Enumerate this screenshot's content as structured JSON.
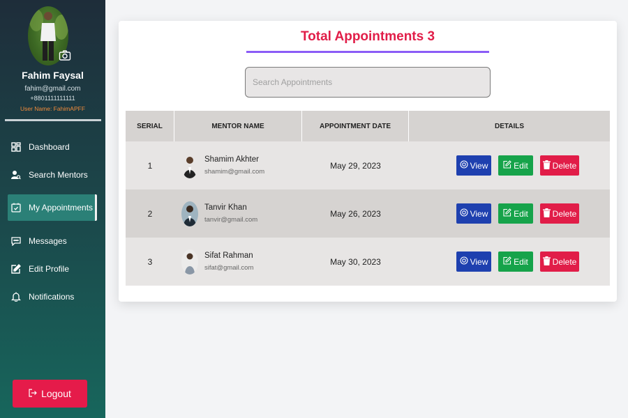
{
  "sidebar": {
    "profile": {
      "name": "Fahim Faysal",
      "email": "fahim@gmail.com",
      "phone": "+8801111111111",
      "username": "User Name: FahimAPFF"
    },
    "items": [
      {
        "label": "Dashboard",
        "icon": "dashboard-icon"
      },
      {
        "label": "Search Mentors",
        "icon": "user-search-icon"
      },
      {
        "label": "My Appointments",
        "icon": "calendar-check-icon",
        "active": true
      },
      {
        "label": "Messages",
        "icon": "message-icon"
      },
      {
        "label": "Edit Profile",
        "icon": "edit-icon"
      },
      {
        "label": "Notifications",
        "icon": "bell-icon"
      }
    ],
    "logout_label": "Logout"
  },
  "main": {
    "title": "Total Appointments 3",
    "search_placeholder": "Search Appointments",
    "table": {
      "headers": [
        "SERIAL",
        "MENTOR NAME",
        "APPOINTMENT DATE",
        "DETAILS"
      ],
      "rows": [
        {
          "serial": "1",
          "name": "Shamim Akhter",
          "email": "shamim@gmail.com",
          "date": "May 29, 2023"
        },
        {
          "serial": "2",
          "name": "Tanvir Khan",
          "email": "tanvir@gmail.com",
          "date": "May 26, 2023"
        },
        {
          "serial": "3",
          "name": "Sifat Rahman",
          "email": "sifat@gmail.com",
          "date": "May 30, 2023"
        }
      ],
      "actions": {
        "view": "View",
        "edit": "Edit",
        "delete": "Delete"
      }
    }
  },
  "colors": {
    "accent": "#e11d48",
    "title_underline": "#8b5cf6",
    "view": "#1e40af",
    "edit": "#16a34a",
    "delete": "#e11d48",
    "username": "#f08a3a"
  }
}
